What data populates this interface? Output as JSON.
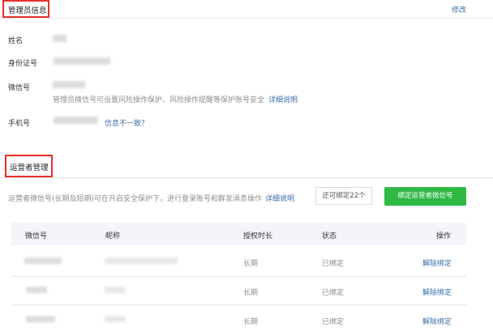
{
  "admin": {
    "section_title": "管理员信息",
    "edit_link": "修改",
    "name_label": "姓名",
    "id_label": "身份证号",
    "wechat_label": "微信号",
    "wechat_hint": "管理员微信号可设置风险操作保护、风险操作提醒等保护账号安全",
    "details_link": "详细说明",
    "phone_label": "手机号",
    "inconsistent_link": "信息不一致？"
  },
  "operators": {
    "section_title": "运营者管理",
    "description": "运营者微信号(长期及短期)可在开启安全保护下，进行登录账号和群发消息操作",
    "details_link": "详细说明",
    "remaining_button": "还可绑定22个",
    "bind_button": "绑定运营者微信号",
    "table": {
      "headers": [
        "微信号",
        "昵称",
        "授权时长",
        "状态",
        "操作"
      ],
      "rows": [
        {
          "duration": "长期",
          "status": "已绑定",
          "action": "解除绑定"
        },
        {
          "duration": "长期",
          "status": "已绑定",
          "action": "解除绑定"
        },
        {
          "duration": "长期",
          "status": "已绑定",
          "action": "解除绑定"
        }
      ]
    }
  },
  "colors": {
    "accent_green": "#2fb844",
    "link_blue": "#3b6ea8",
    "highlight_red": "#e5302b"
  }
}
